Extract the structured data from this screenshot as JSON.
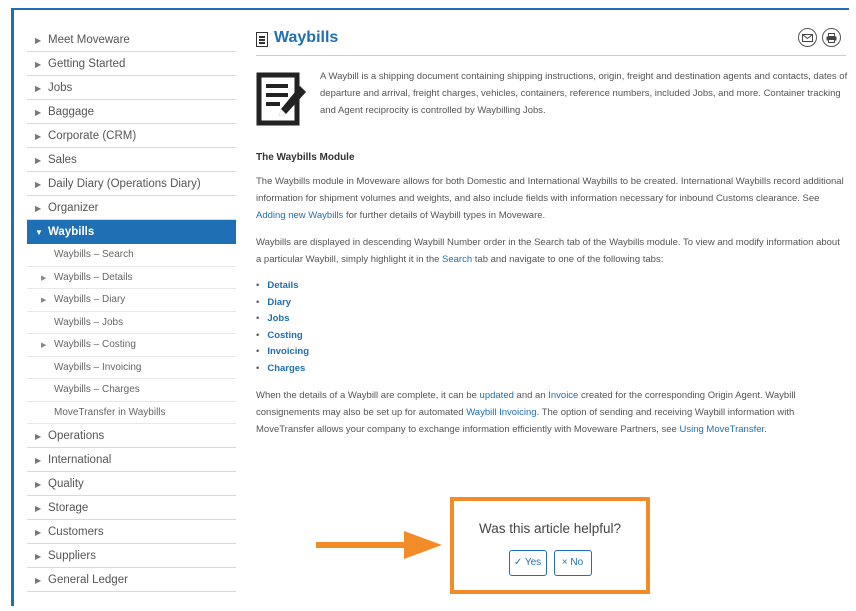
{
  "sidebar": {
    "items_top": [
      {
        "label": "Meet Moveware"
      },
      {
        "label": "Getting Started"
      },
      {
        "label": "Jobs"
      },
      {
        "label": "Baggage"
      },
      {
        "label": "Corporate (CRM)"
      },
      {
        "label": "Sales"
      },
      {
        "label": "Daily Diary (Operations Diary)"
      },
      {
        "label": "Organizer"
      }
    ],
    "active": {
      "label": "Waybills"
    },
    "sub_items": [
      {
        "label": "Waybills – Search",
        "arrow": false
      },
      {
        "label": "Waybills – Details",
        "arrow": true
      },
      {
        "label": "Waybills – Diary",
        "arrow": true
      },
      {
        "label": "Waybills – Jobs",
        "arrow": false
      },
      {
        "label": "Waybills – Costing",
        "arrow": true
      },
      {
        "label": "Waybills – Invoicing",
        "arrow": false
      },
      {
        "label": "Waybills – Charges",
        "arrow": false
      },
      {
        "label": "MoveTransfer in Waybills",
        "arrow": false
      }
    ],
    "items_bottom": [
      {
        "label": "Operations"
      },
      {
        "label": "International"
      },
      {
        "label": "Quality"
      },
      {
        "label": "Storage"
      },
      {
        "label": "Customers"
      },
      {
        "label": "Suppliers"
      },
      {
        "label": "General Ledger"
      }
    ]
  },
  "header": {
    "title": "Waybills",
    "email_icon": "email-icon",
    "print_icon": "print-icon"
  },
  "intro": {
    "text": "A Waybill is a shipping document containing shipping instructions, origin, freight and destination agents and contacts, dates of departure and arrival, freight charges, vehicles, containers, reference numbers, included Jobs, and more. Container tracking and Agent reciprocity is controlled by Waybilling Jobs."
  },
  "module": {
    "heading": "The Waybills Module",
    "p1_a": "The Waybills module in Moveware allows for both Domestic and International Waybills to be created.  International Waybills record additional information for shipment volumes and weights, and also include fields with information necessary for inbound Customs clearance. See ",
    "p1_link": "Adding new Waybills",
    "p1_b": " for further details of Waybill types in Moveware.",
    "p2_a": "Waybills are displayed in descending Waybill Number order in the Search tab of the Waybills module. To view and modify information about a particular Waybill, simply highlight it in the ",
    "p2_link": "Search",
    "p2_b": " tab and navigate to one of the following tabs:",
    "tabs": [
      "Details",
      "Diary",
      "Jobs",
      "Costing",
      "Invoicing",
      "Charges"
    ],
    "p3_a": "When the details of a Waybill are complete, it can be ",
    "p3_link1": "updated",
    "p3_b": " and an ",
    "p3_link2": "Invoice",
    "p3_c": " created for the corresponding Origin Agent.  Waybill consignements may also be set up for automated ",
    "p3_link3": "Waybill Invoicing",
    "p3_d": ". The option of sending and receiving Waybill information with MoveTransfer allows your company to exchange information efficiently with Moveware Partners, see ",
    "p3_link4": "Using MoveTransfer",
    "p3_e": "."
  },
  "feedback": {
    "question": "Was this article helpful?",
    "yes_label": "✓ Yes",
    "no_label": "× No"
  },
  "colors": {
    "accent": "#1f6fb5",
    "highlight": "#f28c28"
  }
}
